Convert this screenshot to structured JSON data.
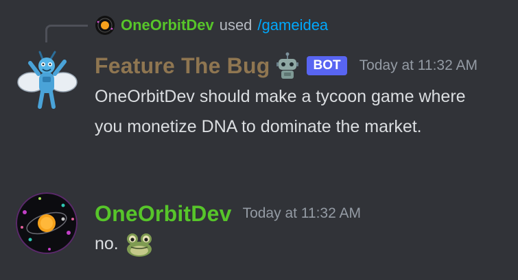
{
  "interaction": {
    "user": "OneOrbitDev",
    "used_text": "used",
    "command": "/gameidea"
  },
  "messages": [
    {
      "author": "Feature The Bug",
      "badge": "BOT",
      "timestamp": "Today at 11:32 AM",
      "content": "OneOrbitDev should make a tycoon game where you monetize DNA to dominate the market.",
      "author_color": "#8f7651",
      "avatar_icon": "blue-bug-mascot"
    },
    {
      "author": "OneOrbitDev",
      "timestamp": "Today at 11:32 AM",
      "content": "no.",
      "author_color": "#57c52a",
      "avatar_icon": "orbit-planet",
      "emoji": "frog-emoji"
    }
  ],
  "colors": {
    "background": "#313338",
    "text": "#dbdee1",
    "muted": "#949ba4",
    "link": "#00a8fc",
    "bot_badge": "#5865f2"
  }
}
